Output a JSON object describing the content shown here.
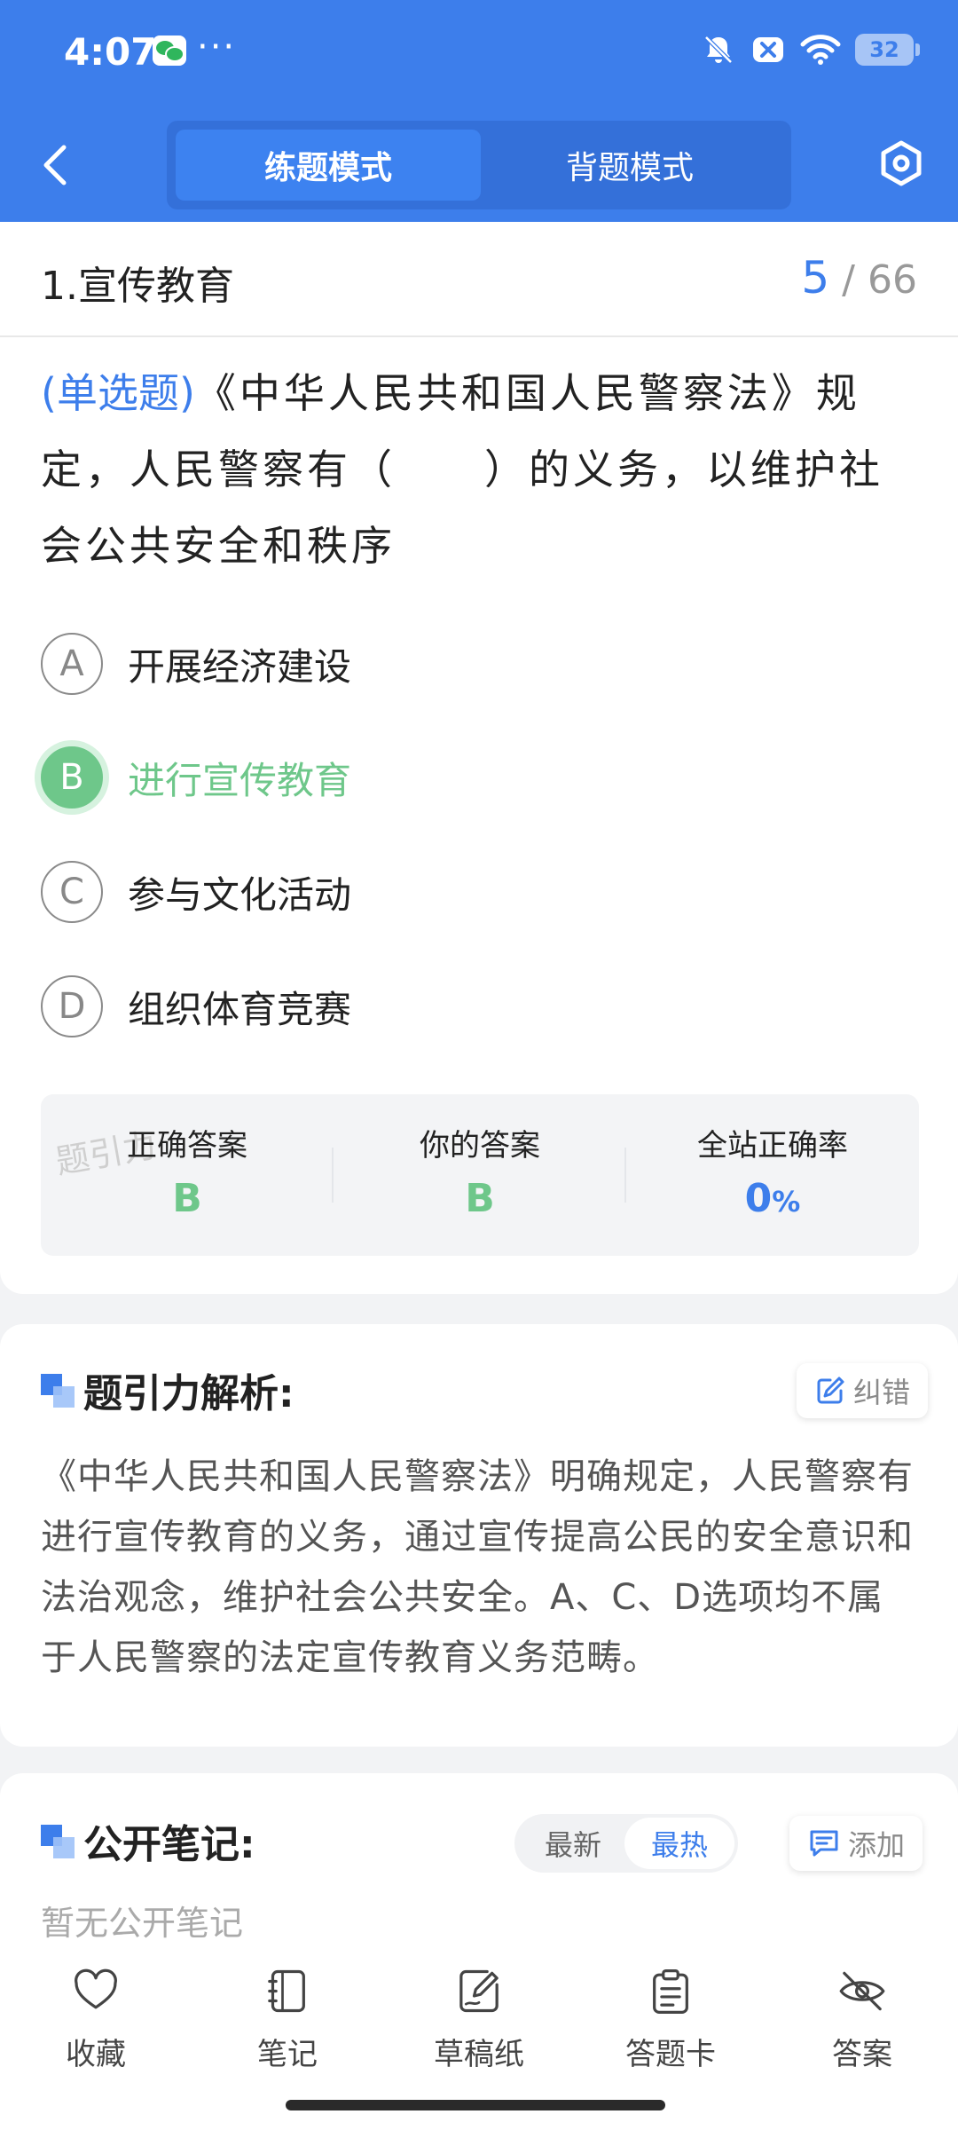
{
  "status": {
    "time": "4:07",
    "more": "···",
    "battery": "32"
  },
  "header": {
    "tabs": [
      {
        "label": "练题模式",
        "active": true
      },
      {
        "label": "背题模式",
        "active": false
      }
    ],
    "icons": [
      "back-arrow-icon",
      "settings-hexagon-icon"
    ]
  },
  "question": {
    "section_title": "1.宣传教育",
    "progress_current": "5",
    "progress_sep": "/",
    "progress_total": "66",
    "type_label": "(单选题)",
    "text": "《中华人民共和国人民警察法》规定，人民警察有（　　）的义务，以维护社会公共安全和秩序",
    "options": [
      {
        "letter": "A",
        "text": "开展经济建设"
      },
      {
        "letter": "B",
        "text": "进行宣传教育"
      },
      {
        "letter": "C",
        "text": "参与文化活动"
      },
      {
        "letter": "D",
        "text": "组织体育竞赛"
      }
    ],
    "correct_option": "B",
    "answer": {
      "correct_label": "正确答案",
      "correct_value": "B",
      "yours_label": "你的答案",
      "yours_value": "B",
      "rate_label": "全站正确率",
      "rate_value": "0",
      "rate_unit": "%",
      "watermark": "题引力"
    }
  },
  "analysis": {
    "title": "题引力解析:",
    "report_label": "纠错",
    "text": "《中华人民共和国人民警察法》明确规定，人民警察有进行宣传教育的义务，通过宣传提高公民的安全意识和法治观念，维护社会公共安全。A、C、D选项均不属于人民警察的法定宣传教育义务范畴。"
  },
  "notes": {
    "title": "公开笔记:",
    "sort_latest": "最新",
    "sort_hot": "最热",
    "add_label": "添加",
    "empty": "暂无公开笔记"
  },
  "colors": {
    "primary": "#3d7eeb",
    "correct": "#6ec78a",
    "background": "#f2f3f5"
  },
  "bottom_nav": [
    {
      "label": "收藏",
      "icon": "heart-icon"
    },
    {
      "label": "笔记",
      "icon": "notebook-icon"
    },
    {
      "label": "草稿纸",
      "icon": "draft-pen-icon"
    },
    {
      "label": "答题卡",
      "icon": "clipboard-icon"
    },
    {
      "label": "答案",
      "icon": "eye-off-icon"
    }
  ]
}
